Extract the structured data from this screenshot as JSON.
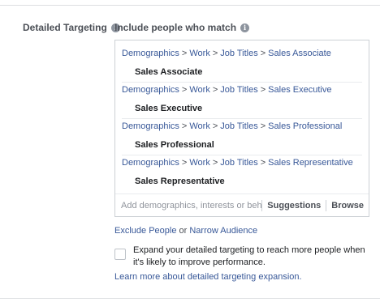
{
  "section": {
    "label": "Detailed Targeting",
    "info_glyph": "i",
    "include_label": "Include people who match"
  },
  "breadcrumb_separator": ">",
  "entries": [
    {
      "path": [
        "Demographics",
        "Work",
        "Job Titles",
        "Sales Associate"
      ],
      "value": "Sales Associate"
    },
    {
      "path": [
        "Demographics",
        "Work",
        "Job Titles",
        "Sales Executive"
      ],
      "value": "Sales Executive"
    },
    {
      "path": [
        "Demographics",
        "Work",
        "Job Titles",
        "Sales Professional"
      ],
      "value": "Sales Professional"
    },
    {
      "path": [
        "Demographics",
        "Work",
        "Job Titles",
        "Sales Representative"
      ],
      "value": "Sales Representative"
    }
  ],
  "search": {
    "placeholder": "Add demographics, interests or behaviors",
    "value": ""
  },
  "buttons": {
    "suggestions": "Suggestions",
    "browse": "Browse"
  },
  "links": {
    "exclude": "Exclude People",
    "or": "or",
    "narrow": "Narrow Audience"
  },
  "expand": {
    "checked": false,
    "text": "Expand your detailed targeting to reach more people when it's likely to improve performance.",
    "learn_more": "Learn more about detailed targeting expansion."
  },
  "colors": {
    "link": "#385898",
    "label": "#4b4f56",
    "border": "#ccd0d5"
  }
}
